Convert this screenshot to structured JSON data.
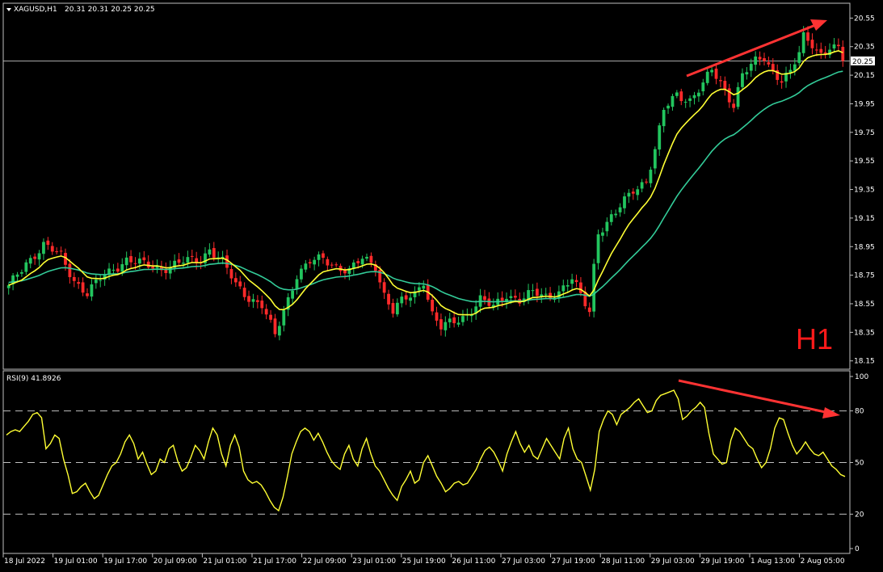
{
  "header": {
    "symbol_label": "XAGUSD,H1",
    "ohlc_text": "20.31 20.31 20.25 20.25"
  },
  "timeframe_watermark": "H1",
  "rsi_header": "RSI(9) 41.8926",
  "current_price_tag": "20.25",
  "colors": {
    "background": "#000000",
    "frame": "#c0c0c0",
    "bull_candle": "#22c55e",
    "bear_candle": "#ff2a2a",
    "fast_ma": "#ffff33",
    "slow_ma": "#33cc99",
    "rsi_line": "#ffff33",
    "trend_arrow": "#ff3333",
    "watermark": "#ff1a1a"
  },
  "chart_data": [
    {
      "type": "candlestick",
      "title": "XAGUSD,H1",
      "x_tick_labels": [
        "18 Jul 2022",
        "19 Jul 01:00",
        "19 Jul 17:00",
        "20 Jul 09:00",
        "21 Jul 01:00",
        "21 Jul 17:00",
        "22 Jul 09:00",
        "23 Jul 01:00",
        "25 Jul 19:00",
        "26 Jul 11:00",
        "27 Jul 03:00",
        "27 Jul 19:00",
        "28 Jul 11:00",
        "29 Jul 03:00",
        "29 Jul 19:00",
        "1 Aug 13:00",
        "2 Aug 05:00"
      ],
      "y_tick_labels": [
        "20.55",
        "20.35",
        "20.15",
        "19.95",
        "19.75",
        "19.55",
        "19.35",
        "19.15",
        "18.95",
        "18.75",
        "18.55",
        "18.35",
        "18.15"
      ],
      "ylim": [
        18.12,
        20.62
      ],
      "current_price": 20.25,
      "price_path": [
        {
          "bar": 0,
          "price": 18.66
        },
        {
          "bar": 4,
          "price": 18.84
        },
        {
          "bar": 8,
          "price": 18.96
        },
        {
          "bar": 12,
          "price": 18.88
        },
        {
          "bar": 15,
          "price": 18.72
        },
        {
          "bar": 18,
          "price": 18.62
        },
        {
          "bar": 21,
          "price": 18.72
        },
        {
          "bar": 24,
          "price": 18.8
        },
        {
          "bar": 27,
          "price": 18.86
        },
        {
          "bar": 31,
          "price": 18.82
        },
        {
          "bar": 35,
          "price": 18.8
        },
        {
          "bar": 40,
          "price": 18.84
        },
        {
          "bar": 44,
          "price": 18.86
        },
        {
          "bar": 46,
          "price": 18.94
        },
        {
          "bar": 49,
          "price": 18.84
        },
        {
          "bar": 52,
          "price": 18.68
        },
        {
          "bar": 55,
          "price": 18.6
        },
        {
          "bar": 58,
          "price": 18.54
        },
        {
          "bar": 61,
          "price": 18.32
        },
        {
          "bar": 63,
          "price": 18.5
        },
        {
          "bar": 66,
          "price": 18.76
        },
        {
          "bar": 69,
          "price": 18.84
        },
        {
          "bar": 72,
          "price": 18.86
        },
        {
          "bar": 75,
          "price": 18.82
        },
        {
          "bar": 78,
          "price": 18.78
        },
        {
          "bar": 81,
          "price": 18.86
        },
        {
          "bar": 84,
          "price": 18.82
        },
        {
          "bar": 86,
          "price": 18.62
        },
        {
          "bar": 88,
          "price": 18.5
        },
        {
          "bar": 90,
          "price": 18.56
        },
        {
          "bar": 93,
          "price": 18.62
        },
        {
          "bar": 95,
          "price": 18.72
        },
        {
          "bar": 97,
          "price": 18.48
        },
        {
          "bar": 99,
          "price": 18.38
        },
        {
          "bar": 102,
          "price": 18.42
        },
        {
          "bar": 105,
          "price": 18.48
        },
        {
          "bar": 108,
          "price": 18.58
        },
        {
          "bar": 111,
          "price": 18.52
        },
        {
          "bar": 114,
          "price": 18.62
        },
        {
          "bar": 117,
          "price": 18.58
        },
        {
          "bar": 120,
          "price": 18.62
        },
        {
          "bar": 123,
          "price": 18.6
        },
        {
          "bar": 126,
          "price": 18.64
        },
        {
          "bar": 129,
          "price": 18.72
        },
        {
          "bar": 131,
          "price": 18.6
        },
        {
          "bar": 133,
          "price": 18.5
        },
        {
          "bar": 134,
          "price": 18.82
        },
        {
          "bar": 135,
          "price": 19.06
        },
        {
          "bar": 139,
          "price": 19.18
        },
        {
          "bar": 143,
          "price": 19.35
        },
        {
          "bar": 146,
          "price": 19.42
        },
        {
          "bar": 148,
          "price": 19.62
        },
        {
          "bar": 150,
          "price": 19.9
        },
        {
          "bar": 153,
          "price": 20.02
        },
        {
          "bar": 156,
          "price": 19.98
        },
        {
          "bar": 159,
          "price": 20.08
        },
        {
          "bar": 161,
          "price": 20.18
        },
        {
          "bar": 163,
          "price": 20.1
        },
        {
          "bar": 165,
          "price": 20.0
        },
        {
          "bar": 166,
          "price": 19.95
        },
        {
          "bar": 168,
          "price": 20.15
        },
        {
          "bar": 171,
          "price": 20.24
        },
        {
          "bar": 173,
          "price": 20.28
        },
        {
          "bar": 175,
          "price": 20.18
        },
        {
          "bar": 177,
          "price": 20.12
        },
        {
          "bar": 179,
          "price": 20.16
        },
        {
          "bar": 181,
          "price": 20.3
        },
        {
          "bar": 182,
          "price": 20.42
        },
        {
          "bar": 184,
          "price": 20.38
        },
        {
          "bar": 186,
          "price": 20.3
        },
        {
          "bar": 188,
          "price": 20.34
        },
        {
          "bar": 190,
          "price": 20.32
        },
        {
          "bar": 191,
          "price": 20.25
        }
      ],
      "series": [
        {
          "name": "fast moving average",
          "description": "yellow"
        },
        {
          "name": "slow moving average",
          "description": "green"
        }
      ]
    },
    {
      "type": "line",
      "title": "RSI(9) 41.8926",
      "y_tick_labels": [
        "100",
        "80",
        "50",
        "20",
        "0"
      ],
      "levels": [
        80,
        50,
        20
      ],
      "ylim": [
        0,
        100
      ],
      "last_value": 41.8926,
      "values": [
        66,
        68,
        69,
        68,
        71,
        74,
        78,
        79,
        76,
        58,
        61,
        66,
        64,
        52,
        43,
        32,
        33,
        36,
        38,
        33,
        29,
        31,
        37,
        43,
        48,
        50,
        55,
        62,
        66,
        61,
        52,
        56,
        49,
        43,
        45,
        52,
        50,
        58,
        60,
        51,
        45,
        47,
        53,
        60,
        57,
        52,
        62,
        70,
        66,
        55,
        48,
        60,
        66,
        59,
        45,
        40,
        38,
        39,
        37,
        33,
        28,
        24,
        22,
        30,
        42,
        55,
        62,
        68,
        70,
        68,
        63,
        67,
        62,
        56,
        51,
        48,
        46,
        55,
        60,
        52,
        48,
        58,
        64,
        55,
        48,
        45,
        40,
        35,
        31,
        28,
        36,
        40,
        45,
        38,
        40,
        50,
        54,
        48,
        42,
        38,
        33,
        35,
        38,
        39,
        37,
        38,
        42,
        46,
        52,
        57,
        59,
        56,
        51,
        45,
        55,
        62,
        68,
        61,
        56,
        60,
        54,
        52,
        58,
        64,
        60,
        56,
        52,
        64,
        70,
        58,
        52,
        50,
        42,
        34,
        46,
        68,
        75,
        80,
        78,
        72,
        78,
        80,
        82,
        85,
        87,
        83,
        79,
        80,
        86,
        89,
        90,
        91,
        92,
        87,
        75,
        77,
        80,
        82,
        85,
        82,
        67,
        55,
        52,
        49,
        50,
        63,
        70,
        68,
        64,
        60,
        58,
        52,
        47,
        50,
        58,
        70,
        76,
        75,
        67,
        60,
        55,
        58,
        62,
        58,
        55,
        54,
        56,
        52,
        48,
        46,
        43,
        41.9
      ]
    }
  ]
}
